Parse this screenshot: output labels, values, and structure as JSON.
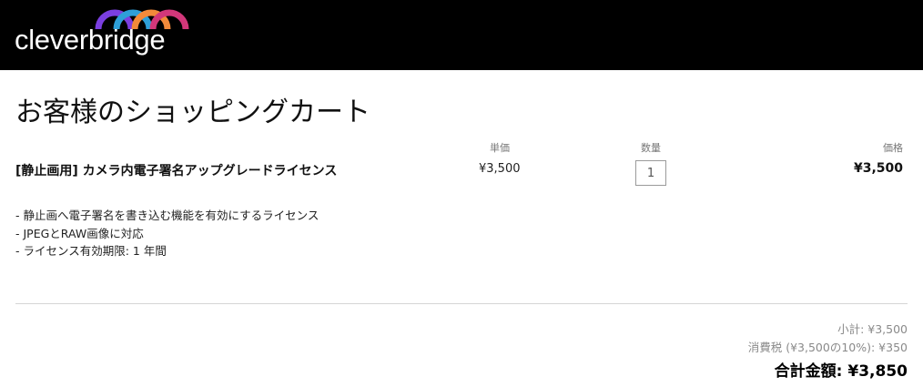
{
  "brand": {
    "logo_text": "cleverbridge",
    "colors": {
      "header_bg": "#000000",
      "arc_1": "#7b3fe0",
      "arc_2": "#2e9fd8",
      "arc_3": "#f28a3a",
      "arc_4": "#d2377a"
    }
  },
  "page": {
    "title": "お客様のショッピングカート"
  },
  "cart": {
    "columns": {
      "unit_price": "単価",
      "quantity": "数量",
      "price": "価格"
    },
    "item": {
      "name": "[静止画用] カメラ内電子署名アップグレードライセンス",
      "unit_price": "¥3,500",
      "quantity": "1",
      "price": "¥3,500",
      "description": [
        "- 静止画へ電子署名を書き込む機能を有効にするライセンス",
        "- JPEGとRAW画像に対応",
        "- ライセンス有効期限: 1 年間"
      ]
    }
  },
  "summary": {
    "subtotal": "小計: ¥3,500",
    "tax": "消費税 (¥3,500の10%): ¥350",
    "total": "合計金額: ¥3,850"
  }
}
